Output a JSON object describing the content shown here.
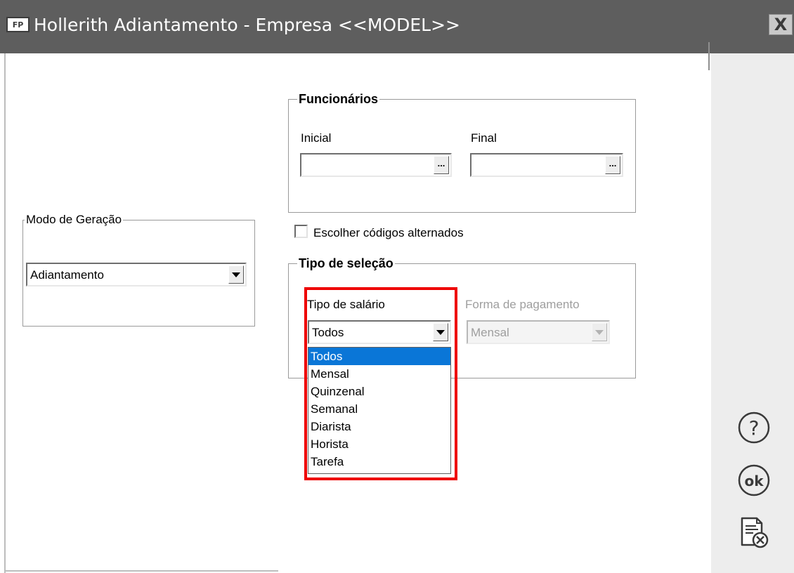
{
  "window": {
    "icon_text": "FP",
    "title": "Hollerith Adiantamento - Empresa <<MODEL>>",
    "close_glyph": "X"
  },
  "modo_geracao": {
    "legend": "Modo de Geração",
    "value": "Adiantamento"
  },
  "funcionarios": {
    "legend": "Funcionários",
    "inicial_label": "Inicial",
    "inicial_value": "",
    "final_label": "Final",
    "final_value": "",
    "browse_glyph": "..."
  },
  "escolher_codigos": {
    "label": "Escolher códigos alternados",
    "checked": false
  },
  "tipo_selecao": {
    "legend": "Tipo de seleção",
    "tipo_salario_label": "Tipo de salário",
    "tipo_salario_value": "Todos",
    "tipo_salario_options": [
      "Todos",
      "Mensal",
      "Quinzenal",
      "Semanal",
      "Diarista",
      "Horista",
      "Tarefa"
    ],
    "forma_pagamento_label": "Forma de pagamento",
    "forma_pagamento_value": "Mensal"
  },
  "side_toolbar": {
    "icons": [
      "help-icon",
      "ok-icon",
      "cancel-document-icon"
    ],
    "ok_text": "ok",
    "help_text": "?"
  },
  "colors": {
    "titlebar": "#5e5e5e",
    "selection": "#0a76d7",
    "highlight": "#ee0000",
    "side_panel": "#ededed"
  }
}
